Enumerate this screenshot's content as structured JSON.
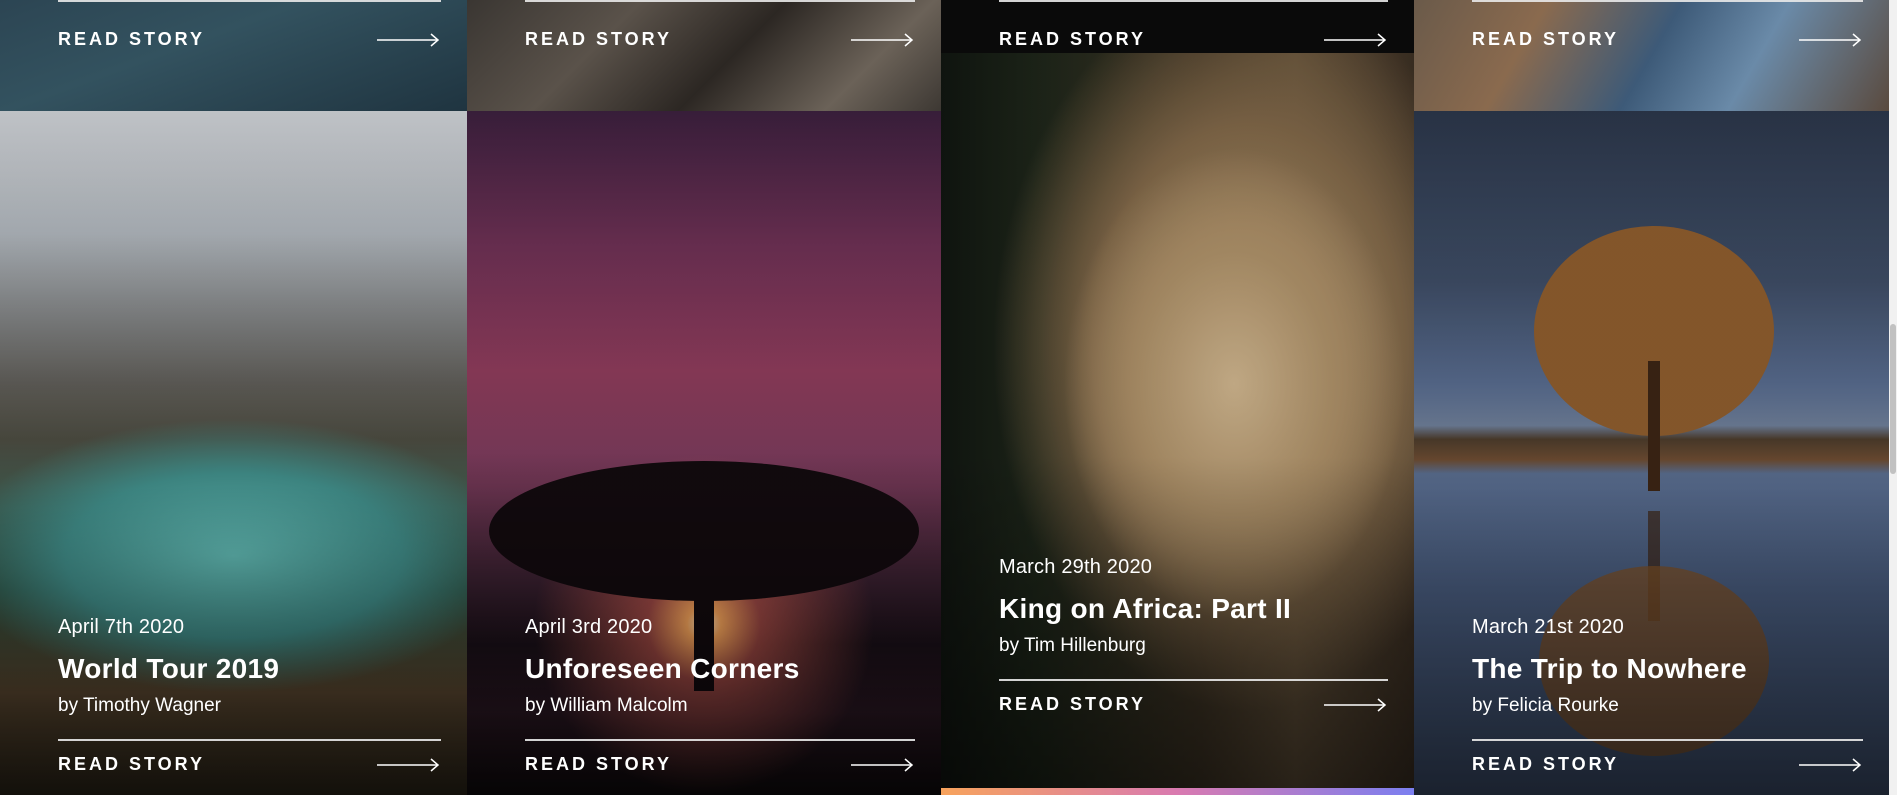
{
  "cards": {
    "read_label": "READ STORY",
    "col1": {
      "date": "April 7th 2020",
      "title": "World Tour 2019",
      "author": "by Timothy Wagner"
    },
    "col2": {
      "date": "April 3rd 2020",
      "title": "Unforeseen Corners",
      "author": "by William Malcolm"
    },
    "col3": {
      "date": "March 29th 2020",
      "title": "King on Africa: Part II",
      "author": "by Tim Hillenburg"
    },
    "col4": {
      "date": "March 21st 2020",
      "title": "The Trip to Nowhere",
      "author": "by Felicia Rourke"
    }
  },
  "icons": {
    "arrow": "right-arrow-icon"
  },
  "colors": {
    "text": "#ffffff",
    "rule": "#e9e9e9",
    "accent_strip": [
      "#f7a35c",
      "#d97ab0",
      "#7b7ff0"
    ]
  }
}
